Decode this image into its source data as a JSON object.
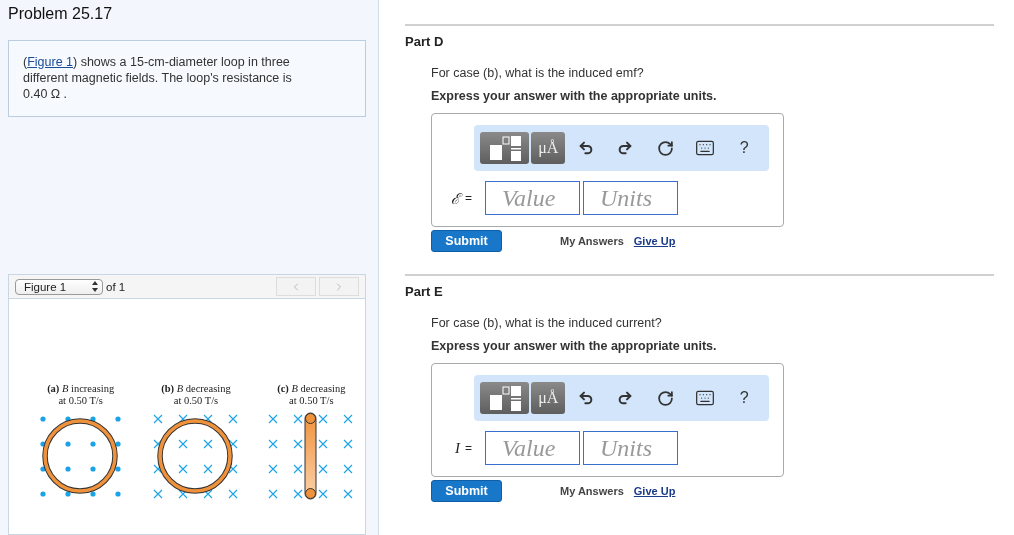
{
  "problem": {
    "title": "Problem 25.17",
    "text_before": "(",
    "link": "Figure 1",
    "text_after": ") shows a 15-cm-diameter loop in three different magnetic fields. The loop's resistance is 0.40  Ω ."
  },
  "figure_viewer": {
    "select": "Figure 1",
    "count": "of 1",
    "prev_disabled": true,
    "next_disabled": true,
    "panels": [
      {
        "caption": "**(a)** *B* increasing",
        "rate": "at 0.50 T/s",
        "kind": "loop",
        "field_out_of_page": true
      },
      {
        "caption": "**(b)** *B* decreasing",
        "rate": "at 0.50 T/s",
        "kind": "loop",
        "field_out_of_page": false
      },
      {
        "caption": "**(c)** *B* decreasing",
        "rate": "at 0.50 T/s",
        "kind": "rod",
        "field_out_of_page": false
      }
    ]
  },
  "parts": [
    {
      "title": "Part D",
      "question": "For case (b), what is the induced emf?",
      "instruction": "Express your answer with the appropriate units.",
      "variable": "ℰ",
      "equals": "=",
      "value_placeholder": "Value",
      "units_placeholder": "Units",
      "toolbar": [
        {
          "kind": "templates"
        },
        {
          "kind": "units",
          "label": "μÅ"
        },
        {
          "kind": "undo"
        },
        {
          "kind": "redo"
        },
        {
          "kind": "reset"
        },
        {
          "kind": "keyboard"
        },
        {
          "kind": "help",
          "label": "?"
        }
      ],
      "submit": "Submit",
      "my_answers": "My Answers",
      "give_up": "Give Up"
    },
    {
      "title": "Part E",
      "question": "For case (b), what is the induced current?",
      "instruction": "Express your answer with the appropriate units.",
      "variable": "I",
      "equals": "=",
      "value_placeholder": "Value",
      "units_placeholder": "Units",
      "toolbar": [
        {
          "kind": "templates"
        },
        {
          "kind": "units",
          "label": "μÅ"
        },
        {
          "kind": "undo"
        },
        {
          "kind": "redo"
        },
        {
          "kind": "reset"
        },
        {
          "kind": "keyboard"
        },
        {
          "kind": "help",
          "label": "?"
        }
      ],
      "submit": "Submit",
      "my_answers": "My Answers",
      "give_up": "Give Up"
    }
  ]
}
